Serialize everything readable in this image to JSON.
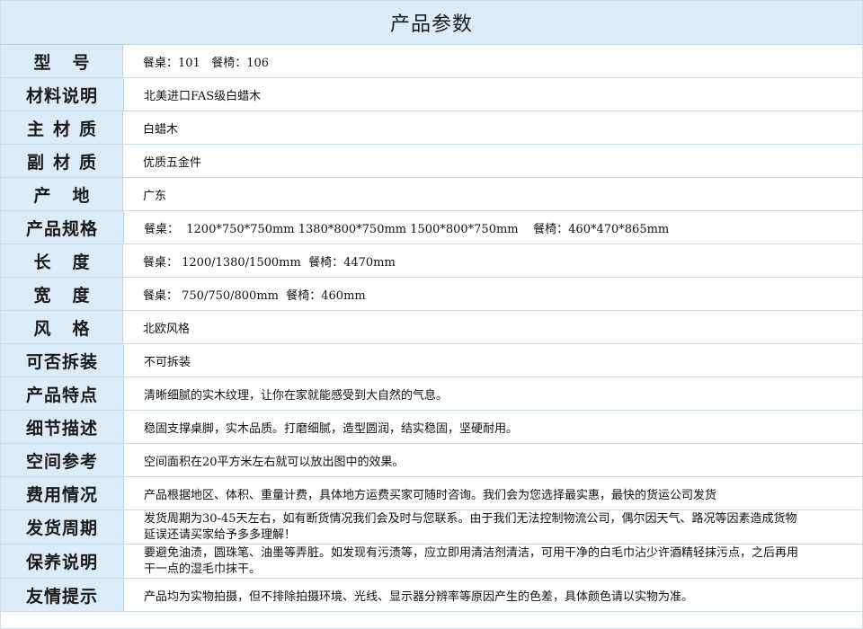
{
  "title": "产品参数",
  "rows": [
    {
      "label": "型号",
      "value": "餐桌：101   餐椅：106"
    },
    {
      "label": "材料说明",
      "value": "北美进口FAS级白蜡木"
    },
    {
      "label": "主材质",
      "value": "白蜡木"
    },
    {
      "label": "副材质",
      "value": "优质五金件"
    },
    {
      "label": "产地",
      "value": "广东"
    },
    {
      "label": "产品规格",
      "value": "餐桌：  1200*750*750mm 1380*800*750mm 1500*800*750mm    餐椅：460*470*865mm"
    },
    {
      "label": "长度",
      "value": "餐桌： 1200/1380/1500mm  餐椅：4470mm"
    },
    {
      "label": "宽度",
      "value": "餐桌： 750/750/800mm  餐椅：460mm"
    },
    {
      "label": "风格",
      "value": "北欧风格"
    },
    {
      "label": "可否拆装",
      "value": "不可拆装"
    },
    {
      "label": "产品特点",
      "value": "清晰细腻的实木纹理，让你在家就能感受到大自然的气息。"
    },
    {
      "label": "细节描述",
      "value": "稳固支撑桌脚，实木品质。打磨细腻，造型圆润，结实稳固，坚硬耐用。"
    },
    {
      "label": "空间参考",
      "value": "空间面积在20平方米左右就可以放出图中的效果。"
    },
    {
      "label": "费用情况",
      "value": "产品根据地区、体积、重量计费，具体地方运费买家可随时咨询。我们会为您选择最实惠，最快的货运公司发货"
    },
    {
      "label": "发货周期",
      "value": "发货周期为30-45天左右，如有断货情况我们会及时与您联系。由于我们无法控制物流公司，偶尔因天气、路况等因素造成货物延误还请买家给予多多理解！"
    },
    {
      "label": "保养说明",
      "value": "要避免油渍，圆珠笔、油墨等弄脏。如发现有污渍等，应立即用清洁剂清洁，可用干净的白毛巾沾少许酒精轻抹污点，之后再用干一点的湿毛巾抹干。"
    },
    {
      "label": "友情提示",
      "value": "产品均为实物拍摄，但不排除拍摄环境、光线、显示器分辨率等原因产生的色差，具体颜色请以实物为准。"
    }
  ]
}
